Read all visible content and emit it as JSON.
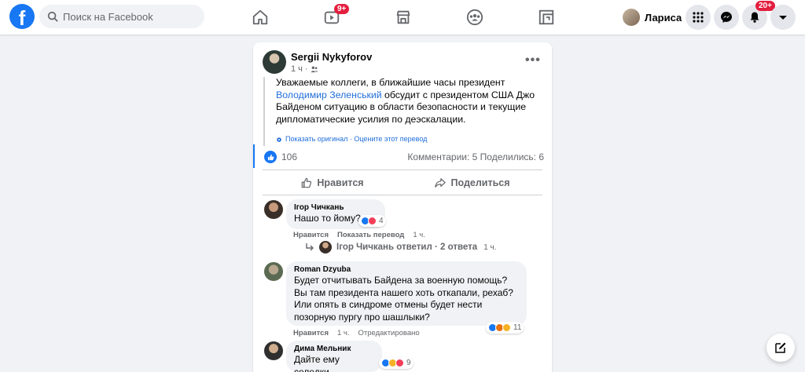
{
  "topbar": {
    "logo_letter": "f",
    "search_placeholder": "Поиск на Facebook",
    "watch_badge": "9+",
    "profile_name": "Лариса",
    "notifications_badge": "20+"
  },
  "post": {
    "author": "Sergii Nykyforov",
    "time": "1 ч",
    "text_before_link": "Уважаемые коллеги, в ближайшие часы президент ",
    "link_text": "Володимир Зеленський",
    "text_after_link": " обсудит с президентом США Джо Байденом ситуацию в области безопасности и текущие дипломатические усилия по деэскалации.",
    "translate_show_original": "Показать оригинал",
    "translate_rate": "Оцените этот перевод",
    "likes_count": "106",
    "comments_shares": "Комментарии: 5  Поделились: 6",
    "like_label": "Нравится",
    "share_label": "Поделиться"
  },
  "comments": [
    {
      "name": "Ігор Чичкань",
      "text": "Нашо то йому?",
      "reactions_count": "4",
      "like": "Нравится",
      "translate": "Показать перевод",
      "time": "1 ч.",
      "edited": ""
    },
    {
      "name": "Roman Dzyuba",
      "text": "Будет отчитывать Байдена за военную помощь? Вы там президента нашего хоть откапали, рехаб? Или опять в синдроме отмены будет нести позорную пургу про шашлыки?",
      "reactions_count": "11",
      "like": "Нравится",
      "translate": "",
      "time": "1 ч.",
      "edited": "Отредактировано"
    },
    {
      "name": "Дима Мельник",
      "text": "Дайте ему селедки...",
      "reactions_count": "9",
      "like": "",
      "translate": "",
      "time": "",
      "edited": ""
    }
  ],
  "reply": {
    "text": "Ігор Чичкань ответил · 2 ответа",
    "time": "1 ч."
  },
  "colors": {
    "brand": "#1877f2",
    "link": "#216fdb",
    "badge": "#e41e3f"
  }
}
